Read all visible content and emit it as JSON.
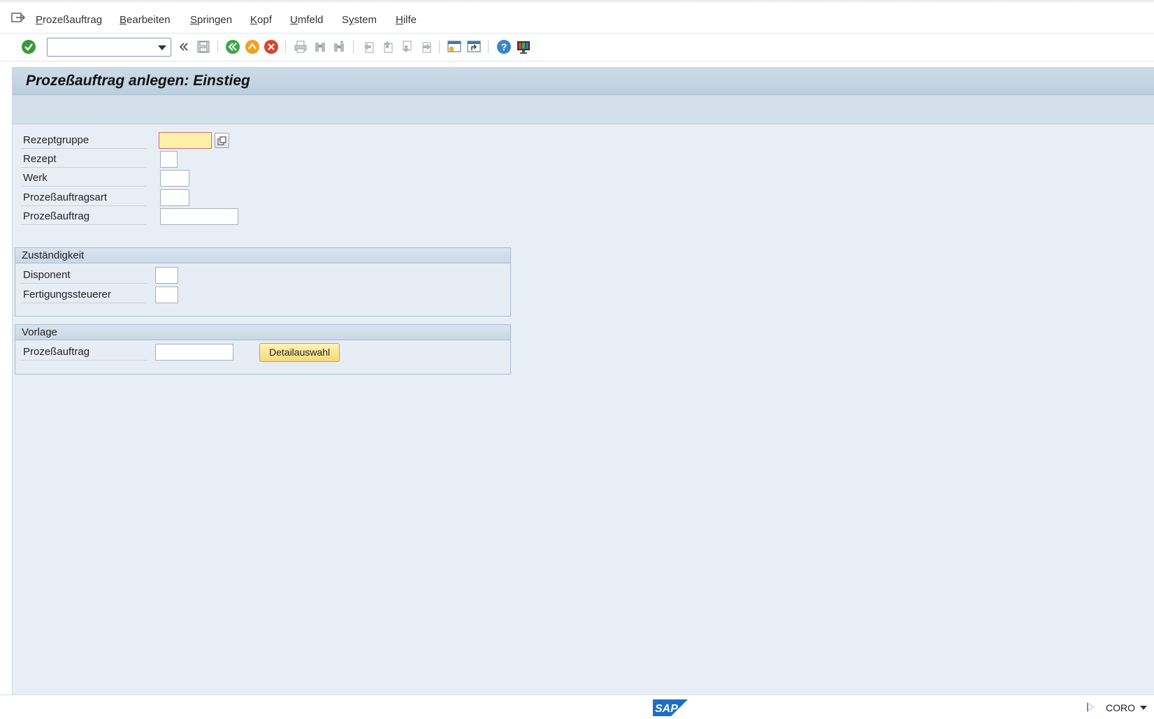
{
  "menu": {
    "items": [
      {
        "label": "Prozeßauftrag",
        "hotkey": "P"
      },
      {
        "label": "Bearbeiten",
        "hotkey": "B"
      },
      {
        "label": "Springen",
        "hotkey": "S"
      },
      {
        "label": "Kopf",
        "hotkey": "K"
      },
      {
        "label": "Umfeld",
        "hotkey": "U"
      },
      {
        "label": "System",
        "hotkey": "y"
      },
      {
        "label": "Hilfe",
        "hotkey": "H"
      }
    ]
  },
  "toolbar": {
    "command_value": "",
    "colors": {
      "ok": "#3a9a3a",
      "back": "#3aa64a",
      "exit": "#f0a020",
      "cancel": "#d9442a",
      "help": "#3c86c8"
    }
  },
  "screen": {
    "title": "Prozeßauftrag anlegen: Einstieg"
  },
  "fields": {
    "rezeptgruppe": {
      "label": "Rezeptgruppe",
      "value": ""
    },
    "rezept": {
      "label": "Rezept",
      "value": ""
    },
    "werk": {
      "label": "Werk",
      "value": ""
    },
    "auftragsart": {
      "label": "Prozeßauftragsart",
      "value": ""
    },
    "auftrag": {
      "label": "Prozeßauftrag",
      "value": ""
    }
  },
  "zustaendigkeit": {
    "title": "Zuständigkeit",
    "disponent": {
      "label": "Disponent",
      "value": ""
    },
    "fertigungssteuerer": {
      "label": "Fertigungssteuerer",
      "value": ""
    }
  },
  "vorlage": {
    "title": "Vorlage",
    "auftrag": {
      "label": "Prozeßauftrag",
      "value": ""
    },
    "detail_button": "Detailauswahl"
  },
  "status": {
    "logo": "SAP",
    "transaction": "CORO"
  }
}
